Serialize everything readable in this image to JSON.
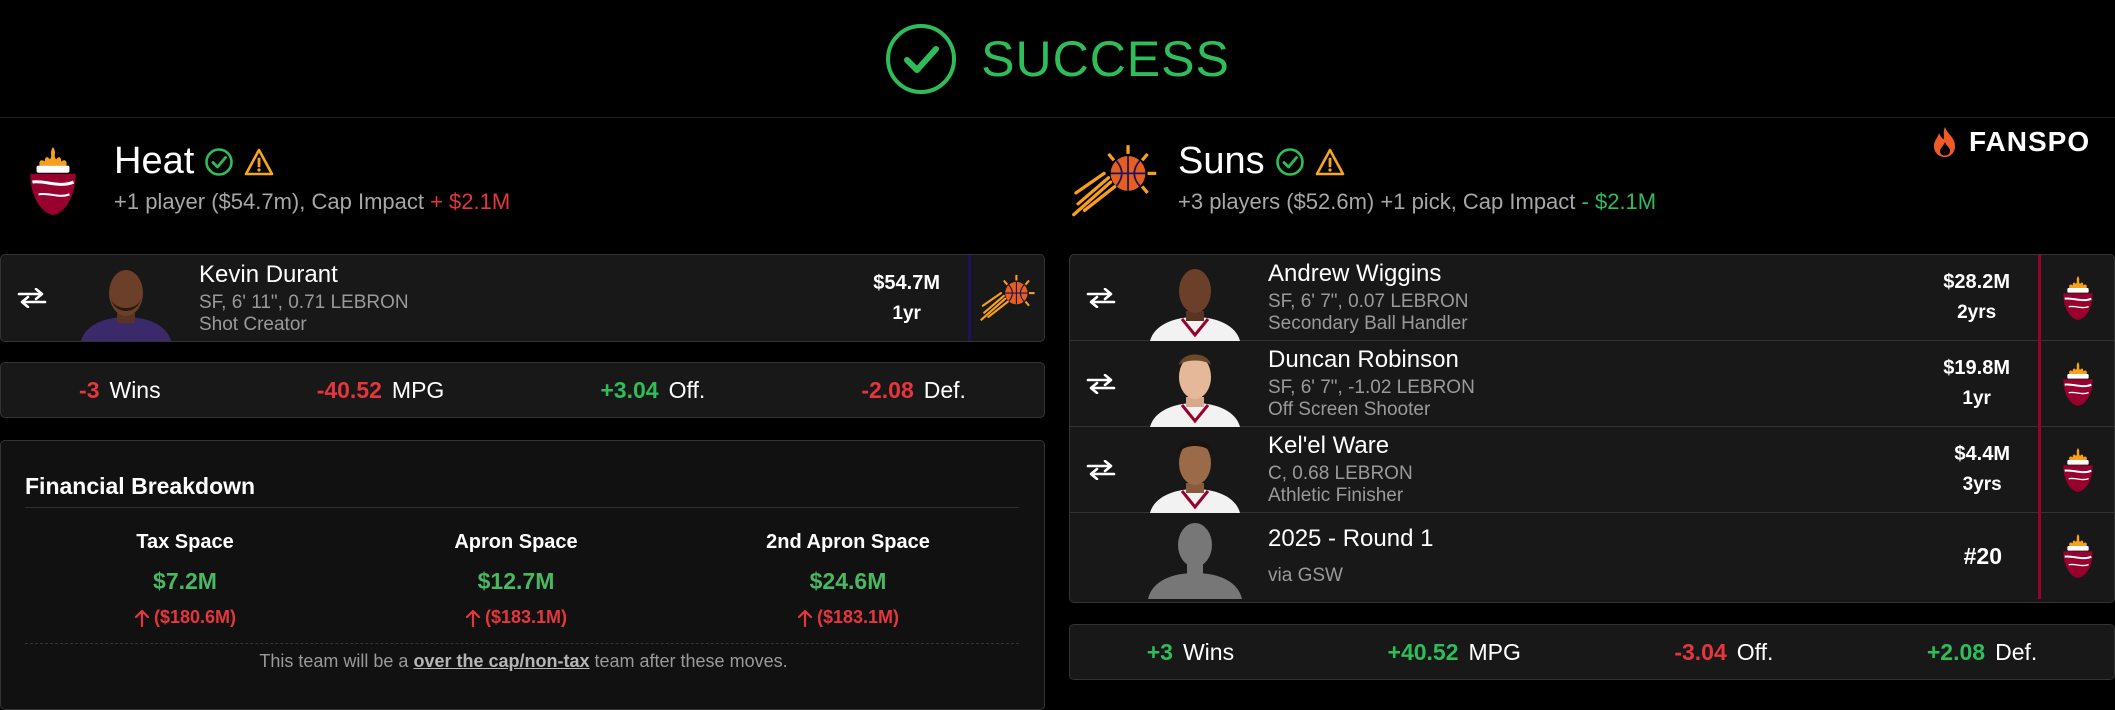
{
  "banner": {
    "text": "SUCCESS",
    "color": "#2ebd59"
  },
  "brand": {
    "name": "FANSPO"
  },
  "heat": {
    "name": "Heat",
    "summary_prefix": "+1 player ($54.7m), Cap Impact ",
    "cap_impact": "+ $2.1M",
    "players": [
      {
        "name": "Kevin Durant",
        "detail1": "SF, 6' 11\", 0.71 LEBRON",
        "detail2": "Shot Creator",
        "salary": "$54.7M",
        "years": "1yr",
        "dest_logo": "suns-logo-icon"
      }
    ],
    "stats": [
      {
        "value": "-3",
        "label": "Wins",
        "tone": "neg"
      },
      {
        "value": "-40.52",
        "label": "MPG",
        "tone": "neg"
      },
      {
        "value": "+3.04",
        "label": "Off.",
        "tone": "pos"
      },
      {
        "value": "-2.08",
        "label": "Def.",
        "tone": "neg"
      }
    ],
    "financial": {
      "title": "Financial Breakdown",
      "columns": [
        {
          "label": "Tax Space",
          "value": "$7.2M",
          "change": "($180.6M)"
        },
        {
          "label": "Apron Space",
          "value": "$12.7M",
          "change": "($183.1M)"
        },
        {
          "label": "2nd Apron Space",
          "value": "$24.6M",
          "change": "($183.1M)"
        }
      ],
      "note_pre": "This team will be a ",
      "note_bold": "over the cap/non-tax",
      "note_post": " team after these moves."
    }
  },
  "suns": {
    "name": "Suns",
    "summary_prefix": "+3 players ($52.6m) +1 pick, Cap Impact ",
    "cap_impact": "- $2.1M",
    "players": [
      {
        "name": "Andrew Wiggins",
        "detail1": "SF, 6' 7\", 0.07 LEBRON",
        "detail2": "Secondary Ball Handler",
        "salary": "$28.2M",
        "years": "2yrs",
        "dest_logo": "heat-logo-icon"
      },
      {
        "name": "Duncan Robinson",
        "detail1": "SF, 6' 7\", -1.02 LEBRON",
        "detail2": "Off Screen Shooter",
        "salary": "$19.8M",
        "years": "1yr",
        "dest_logo": "heat-logo-icon"
      },
      {
        "name": "Kel'el Ware",
        "detail1": "C, 0.68 LEBRON",
        "detail2": "Athletic Finisher",
        "salary": "$4.4M",
        "years": "3yrs",
        "dest_logo": "heat-logo-icon"
      }
    ],
    "pick": {
      "name": "2025 - Round 1",
      "detail": "via GSW",
      "number": "#20",
      "dest_logo": "heat-logo-icon"
    },
    "stats": [
      {
        "value": "+3",
        "label": "Wins",
        "tone": "pos"
      },
      {
        "value": "+40.52",
        "label": "MPG",
        "tone": "pos"
      },
      {
        "value": "-3.04",
        "label": "Off.",
        "tone": "neg"
      },
      {
        "value": "+2.08",
        "label": "Def.",
        "tone": "pos"
      }
    ]
  },
  "colors": {
    "negative": "#e5363e",
    "positive": "#2ebd59",
    "heat_accent": "#98002e",
    "suns_accent": "#1d1160",
    "warning": "#f5a623"
  }
}
